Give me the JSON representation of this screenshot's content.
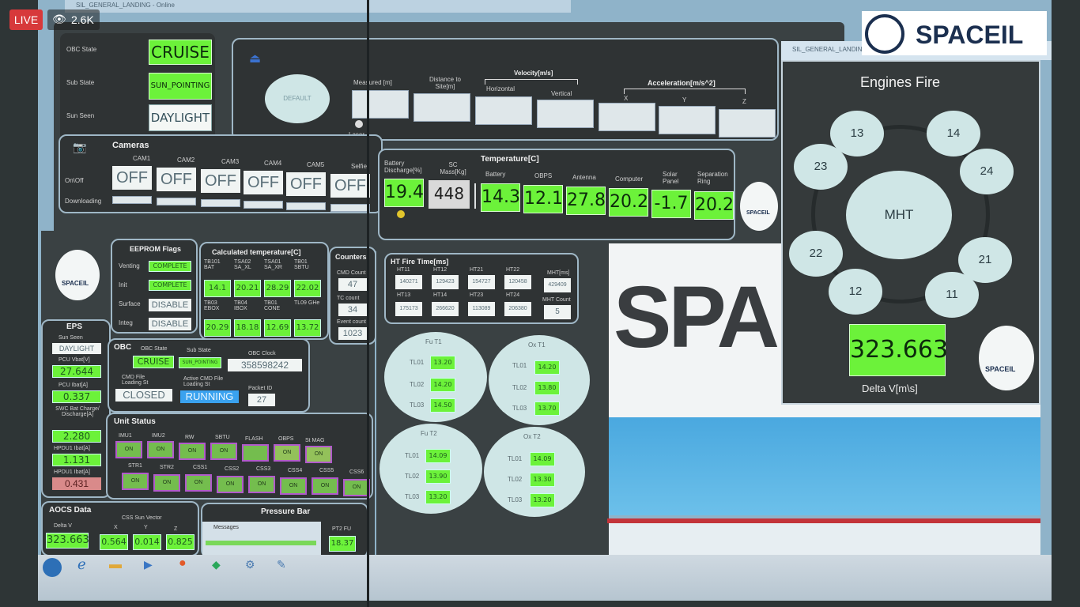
{
  "stream": {
    "live_label": "LIVE",
    "viewers": "2.6K",
    "brand": "SPACEIL"
  },
  "window": {
    "title": "SIL_GENERAL_LANDING - Online",
    "title2": "SIL_GENERAL_LANDING"
  },
  "obc_state_panel": {
    "rows": [
      {
        "label": "OBC State",
        "value": "CRUISE"
      },
      {
        "label": "Sub State",
        "value": "SUN_POINTING"
      },
      {
        "label": "Sun Seen",
        "value": "DAYLIGHT"
      }
    ]
  },
  "nav": {
    "button": "DEFAULT",
    "laser_label": "Laser",
    "measured_label": "Measured [m]",
    "distance_label": "Distance to Site[m]",
    "velocity_label": "Velocity[m/s]",
    "vel_horizontal": "Horizontal",
    "vel_vertical": "Vertical",
    "accel_label": "Acceleration[m/s^2]",
    "ax": "X",
    "ay": "Y",
    "az": "Z"
  },
  "cameras": {
    "title": "Cameras",
    "onoff_label": "On\\Off",
    "downloading_label": "Downloading",
    "items": [
      {
        "name": "CAM1",
        "state": "OFF"
      },
      {
        "name": "CAM2",
        "state": "OFF"
      },
      {
        "name": "CAM3",
        "state": "OFF"
      },
      {
        "name": "CAM4",
        "state": "OFF"
      },
      {
        "name": "CAM5",
        "state": "OFF"
      },
      {
        "name": "Selfie",
        "state": "OFF"
      }
    ]
  },
  "battery": {
    "label": "Battery Discharge[%]",
    "value": "19.4"
  },
  "sc_mass": {
    "label": "SC Mass[Kg]",
    "value": "448"
  },
  "temperature": {
    "title": "Temperature[C]",
    "items": [
      {
        "name": "Battery",
        "value": "14.3"
      },
      {
        "name": "OBPS",
        "value": "12.1"
      },
      {
        "name": "Antenna",
        "value": "27.8"
      },
      {
        "name": "Computer",
        "value": "20.2"
      },
      {
        "name": "Solar Panel",
        "value": "-1.7"
      },
      {
        "name": "Separation Ring",
        "value": "20.2"
      }
    ]
  },
  "engines": {
    "title": "Engines Fire",
    "center": "MHT",
    "items": [
      "13",
      "14",
      "23",
      "24",
      "22",
      "21",
      "12",
      "11"
    ],
    "delta_v": "323.663",
    "delta_v_label": "Delta V[m\\s]"
  },
  "eeprom": {
    "title": "EEPROM Flags",
    "rows": [
      {
        "label": "Venting",
        "value": "COMPLETE"
      },
      {
        "label": "Init",
        "value": "COMPLETE"
      },
      {
        "label": "Surface",
        "value": "DISABLE"
      },
      {
        "label": "Integ",
        "value": "DISABLE"
      }
    ]
  },
  "calc_temp": {
    "title": "Calculated temperature[C]",
    "row1": [
      {
        "name": "TB101 BAT",
        "value": "14.1"
      },
      {
        "name": "TSA02 SA_XL",
        "value": "20.21"
      },
      {
        "name": "TSA01 SA_XR",
        "value": "28.29"
      },
      {
        "name": "TB01 SBTU",
        "value": "22.02"
      }
    ],
    "row2": [
      {
        "name": "TB03 EBOX",
        "value": "20.29"
      },
      {
        "name": "TB04 IBOX",
        "value": "18.18"
      },
      {
        "name": "TB01 CONE",
        "value": "12.69"
      },
      {
        "name": "TL09 GHe",
        "value": "13.72"
      }
    ]
  },
  "counters": {
    "title": "Counters",
    "rows": [
      {
        "label": "CMD Count",
        "value": "47"
      },
      {
        "label": "TC count",
        "value": "34"
      },
      {
        "label": "Event count",
        "value": "1023"
      }
    ]
  },
  "ht_fire": {
    "title": "HT Fire Time[ms]",
    "row1": [
      {
        "name": "HT11",
        "value": "140271"
      },
      {
        "name": "HT12",
        "value": "129423"
      },
      {
        "name": "HT21",
        "value": "154727"
      },
      {
        "name": "HT22",
        "value": "120458"
      }
    ],
    "row2": [
      {
        "name": "HT13",
        "value": "175173"
      },
      {
        "name": "HT14",
        "value": "266620"
      },
      {
        "name": "HT23",
        "value": "113089"
      },
      {
        "name": "HT24",
        "value": "206380"
      }
    ],
    "mht_label": "MHT[ms]",
    "mht_value": "429409",
    "mht_count_label": "MHT Count",
    "mht_count_value": "5"
  },
  "ox": {
    "tanks": [
      {
        "name": "Fu T1",
        "values": [
          "13.20",
          "14.20",
          "14.50"
        ]
      },
      {
        "name": "Ox T1",
        "values": [
          "14.20",
          "13.80",
          "13.70"
        ]
      },
      {
        "name": "Fu T2",
        "values": [
          "14.09",
          "13.90",
          "13.20"
        ]
      },
      {
        "name": "Ox T2",
        "values": [
          "14.09",
          "13.30",
          "13.20"
        ]
      }
    ],
    "tlabels": [
      "TL01",
      "TL02",
      "TL03"
    ]
  },
  "eps": {
    "title": "EPS",
    "rows": [
      {
        "label": "Sun Seen",
        "value": "DAYLIGHT"
      },
      {
        "label": "PCU Vbat[V]",
        "value": "27.644"
      },
      {
        "label": "PCU Ibat[A]",
        "value": "0.337"
      },
      {
        "label": "SWC Bat Charge/ Discharge[A]",
        "value": "2.280"
      },
      {
        "label": "HPDU1 Ibat[A]",
        "value": "1.131"
      },
      {
        "label": "HPDU1 Ibat[A]",
        "value": "0.431"
      }
    ]
  },
  "obc": {
    "title": "OBC",
    "state_label": "OBC State",
    "state": "CRUISE",
    "sub_label": "Sub State",
    "sub": "SUN_POINTING",
    "clock_label": "OBC Clock",
    "clock": "358598242",
    "cmd_file_label": "CMD File Loading St",
    "cmd_file": "CLOSED",
    "active_label": "Active CMD File Loading St",
    "active": "RUNNING",
    "packet_label": "Packet ID",
    "packet": "27"
  },
  "unit_status": {
    "title": "Unit Status",
    "row1": [
      "IMU1",
      "IMU2",
      "RW",
      "SBTU",
      "FLASH",
      "OBPS",
      "St MAG"
    ],
    "row2": [
      "STR1",
      "STR2",
      "CSS1",
      "CSS2",
      "CSS3",
      "CSS4",
      "CSS5",
      "CSS6"
    ],
    "state": "ON"
  },
  "aocs": {
    "title": "AOCS Data",
    "delta_v_label": "Delta V",
    "delta_v": "323.663",
    "css_label": "CSS Sun Vector",
    "x_label": "X",
    "y_label": "Y",
    "z_label": "Z",
    "x": "0.564",
    "y": "0.014",
    "z": "0.825"
  },
  "pressure": {
    "title": "Pressure Bar",
    "messages": "Messages",
    "pt2fu": "PT2 FU",
    "pt2fu_value": "18.37"
  },
  "backdrop": {
    "text": "SPA"
  }
}
